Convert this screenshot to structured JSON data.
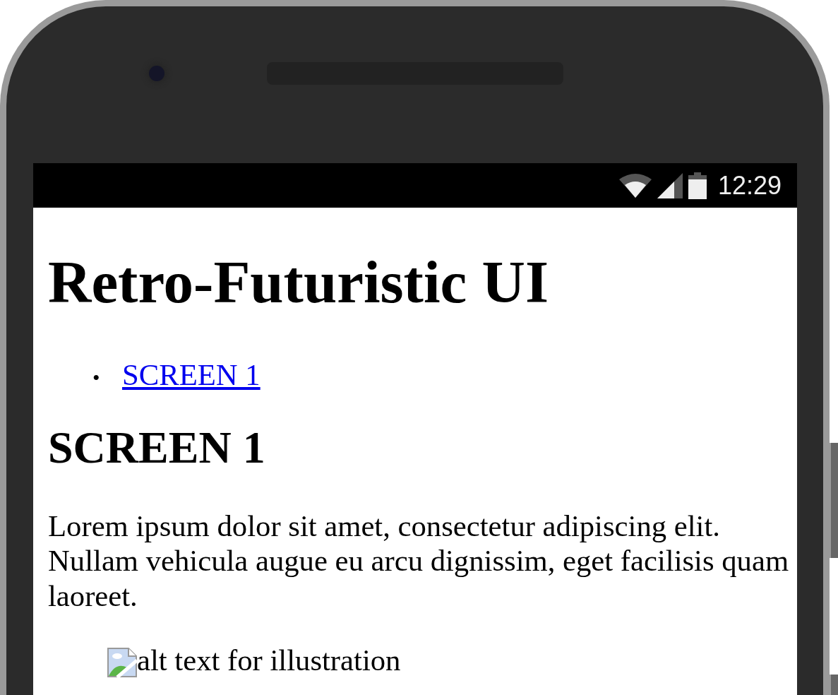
{
  "status_bar": {
    "time": "12:29"
  },
  "page": {
    "title": "Retro-Futuristic UI",
    "nav_links": [
      {
        "marker": "•",
        "label": "SCREEN 1"
      }
    ],
    "section_heading": "SCREEN 1",
    "paragraph": "Lorem ipsum dolor sit amet, consectetur adipiscing elit. Nullam vehicula augue eu arcu dignissim, eget facilisis quam laoreet.",
    "image": {
      "alt_text": "alt text for illustration"
    }
  }
}
